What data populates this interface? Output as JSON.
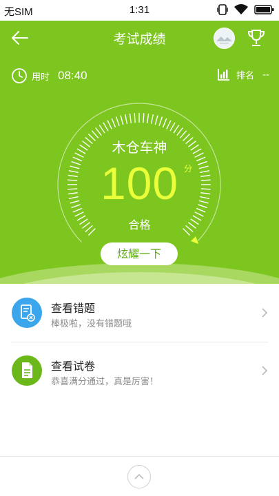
{
  "status_bar": {
    "carrier": "无SIM",
    "time": "1:31"
  },
  "header": {
    "title": "考试成绩"
  },
  "stats": {
    "time_label": "用时",
    "time_value": "08:40",
    "rank_label": "排名",
    "rank_value": "--"
  },
  "result": {
    "title": "木仓车神",
    "score": "100",
    "unit": "分",
    "grade": "合格",
    "score_fraction": 1.0
  },
  "share_button": {
    "label": "炫耀一下"
  },
  "list": {
    "items": [
      {
        "title": "查看错题",
        "subtitle": "棒极啦，没有错题哦",
        "icon": "wrong-questions-icon",
        "color": "#3ba6ec"
      },
      {
        "title": "查看试卷",
        "subtitle": "恭喜满分通过，真是厉害！",
        "icon": "paper-document-icon",
        "color": "#6cb81b"
      }
    ]
  },
  "colors": {
    "primary": "#7dc61f",
    "score": "#e8ff3a",
    "button_text": "#5fae14"
  }
}
